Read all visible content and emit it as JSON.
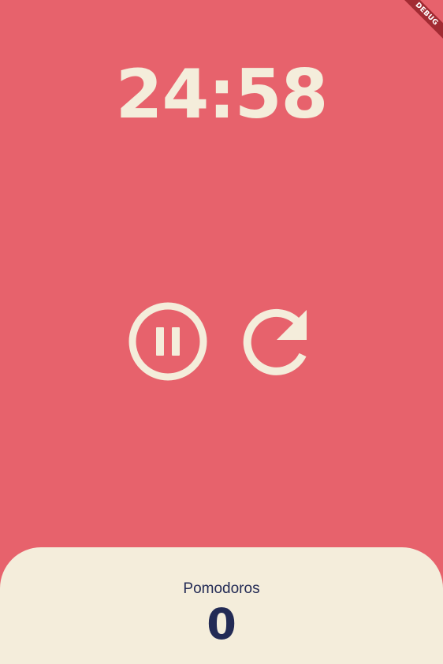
{
  "timer": {
    "display": "24:58"
  },
  "controls": {
    "pause": {
      "icon": "pause-circle-icon"
    },
    "reset": {
      "icon": "restart-icon"
    }
  },
  "pomodoros": {
    "label": "Pomodoros",
    "count": "0"
  },
  "debug_banner": {
    "text": "DEBUG"
  },
  "colors": {
    "background": "#E7626C",
    "card": "#F4EDDB",
    "text_dark": "#232B55",
    "icon": "#F4EDDB",
    "debug_ribbon": "#A22B33"
  }
}
